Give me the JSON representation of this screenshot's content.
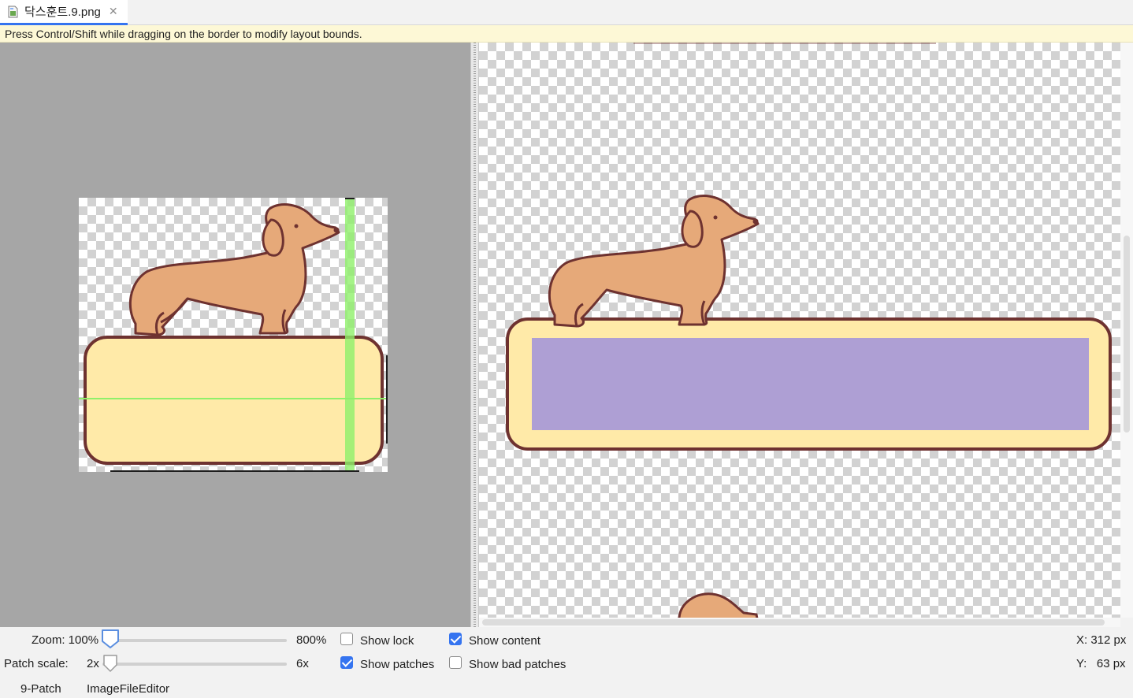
{
  "tab": {
    "filename": "닥스훈트.9.png",
    "close_glyph": "✕"
  },
  "hint": "Press Control/Shift while dragging on the border to modify layout bounds.",
  "controls": {
    "zoom_label": "Zoom: 100%",
    "zoom_max": "800%",
    "patch_scale_label": "Patch scale:",
    "patch_scale_min": "2x",
    "patch_scale_max": "6x",
    "show_lock": {
      "label": "Show lock",
      "checked": false
    },
    "show_patches": {
      "label": "Show patches",
      "checked": true
    },
    "show_content": {
      "label": "Show content",
      "checked": true
    },
    "show_bad_patches": {
      "label": "Show bad patches",
      "checked": false
    },
    "coord_x": "X: 312 px",
    "coord_y": "Y:   63 px"
  },
  "bottom_tabs": [
    "9-Patch",
    "ImageFileEditor"
  ],
  "colors": {
    "editor_bg": "#a6a6a6",
    "dog_fill": "#e6a979",
    "dog_outline": "#6e3230",
    "box_fill": "#ffeaa8",
    "content_area": "#ae9fd4",
    "patch_green": "#8ff06a",
    "accent": "#3574f0"
  },
  "icons": {
    "file": "image-file-icon",
    "close": "close-icon",
    "checkbox": "checkbox-icon"
  }
}
